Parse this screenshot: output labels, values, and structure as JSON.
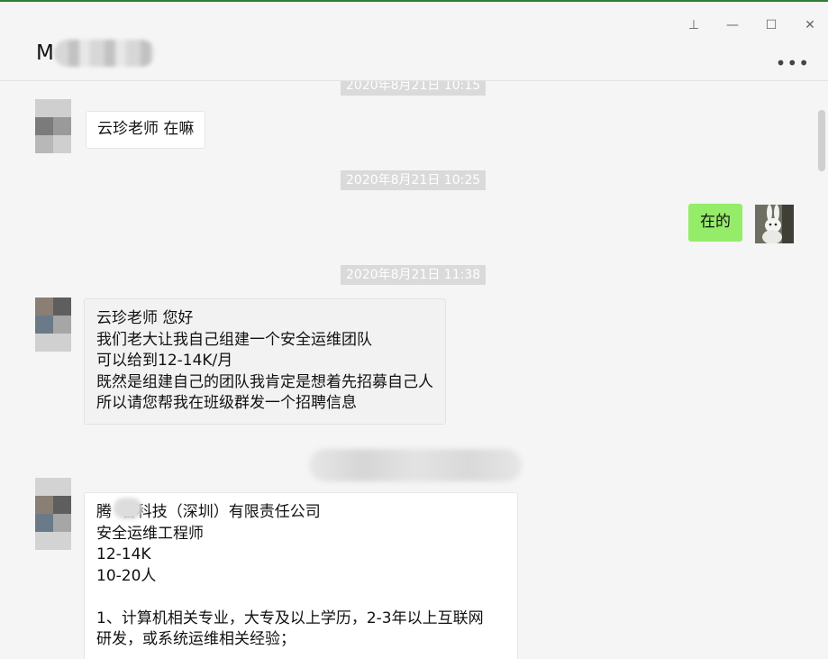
{
  "window": {
    "contact_name": "M",
    "controls": {
      "pin": "⊥",
      "minimize": "—",
      "maximize": "☐",
      "close": "✕"
    },
    "more_label": "•••"
  },
  "messages": [
    {
      "type": "timestamp",
      "text": "2020年8月21日 10:15"
    },
    {
      "type": "incoming",
      "lines": [
        "云珍老师 在嘛"
      ]
    },
    {
      "type": "timestamp",
      "text": "2020年8月21日 10:25"
    },
    {
      "type": "outgoing",
      "lines": [
        "在的"
      ]
    },
    {
      "type": "timestamp",
      "text": "2020年8月21日 11:38"
    },
    {
      "type": "incoming",
      "lines": [
        "云珍老师 您好",
        "我们老大让我自己组建一个安全运维团队",
        "可以给到12-14K/月",
        "既然是组建自己的团队我肯定是想着先招募自己人",
        "所以请您帮我在班级群发一个招聘信息"
      ]
    },
    {
      "type": "incoming",
      "lines": [
        "腾  智科技（深圳）有限责任公司",
        "安全运维工程师",
        "12-14K",
        "10-20人",
        "",
        "1、计算机相关专业，大专及以上学历，2-3年以上互联网",
        "研发，或系统运维相关经验；"
      ]
    }
  ],
  "colors": {
    "outgoing_bubble": "#95ec69",
    "title_accent": "#2e7d32",
    "timestamp_bg": "#dadada"
  }
}
